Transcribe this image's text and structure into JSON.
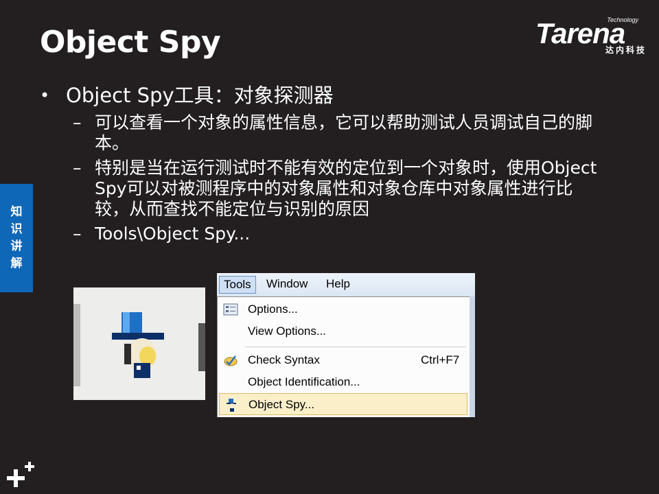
{
  "slide": {
    "title": "Object Spy",
    "logo": {
      "tech": "Technology",
      "name": "Tarena",
      "sub": "达内科技"
    },
    "side_tab": [
      "知",
      "识",
      "讲",
      "解"
    ],
    "bullet": "Object Spy工具：对象探测器",
    "subbullets": [
      "可以查看一个对象的属性信息，它可以帮助测试人员调试自己的脚本。",
      "特别是当在运行测试时不能有效的定位到一个对象时，使用Object Spy可以对被测程序中的对象属性和对象仓库中对象属性进行比较，从而查找不能定位与识别的原因",
      "Tools\\Object Spy..."
    ],
    "dash": "–",
    "dot": "•"
  },
  "menu": {
    "bar": [
      "Tools",
      "Window",
      "Help"
    ],
    "items": [
      {
        "label": "Options...",
        "icon": "options-icon"
      },
      {
        "label": "View Options..."
      },
      {
        "label": "Check Syntax",
        "shortcut": "Ctrl+F7",
        "icon": "check-syntax-icon"
      },
      {
        "label": "Object Identification..."
      },
      {
        "label": "Object Spy...",
        "icon": "object-spy-icon",
        "highlighted": true
      }
    ]
  },
  "colors": {
    "background": "#231f20",
    "side_tab": "#0f67b8",
    "highlight": "#fbefc9"
  }
}
